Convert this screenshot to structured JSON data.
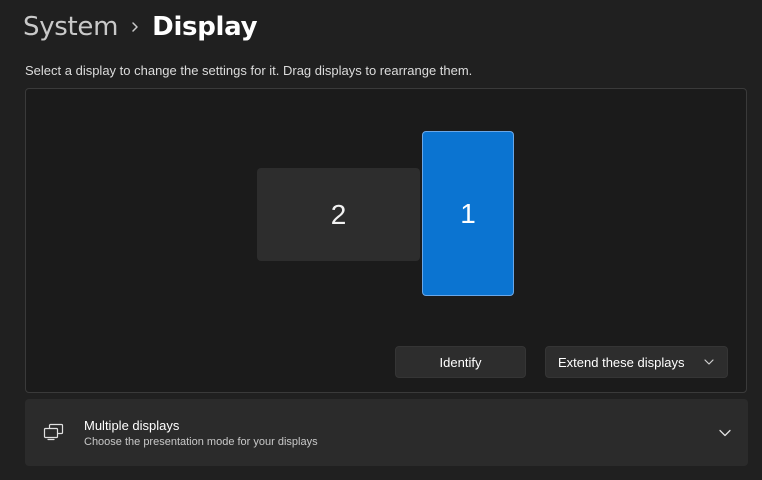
{
  "breadcrumb": {
    "parent": "System",
    "current": "Display",
    "separator_icon": "chevron-right-icon"
  },
  "instructions": "Select a display to change the settings for it. Drag displays to rearrange them.",
  "arrangement": {
    "monitors": [
      {
        "label": "2",
        "selected": false
      },
      {
        "label": "1",
        "selected": true
      }
    ],
    "identify_label": "Identify",
    "mode_select": {
      "value": "Extend these displays",
      "icon": "chevron-down-icon"
    }
  },
  "multiple_displays": {
    "icon": "multiple-displays-icon",
    "title": "Multiple displays",
    "description": "Choose the presentation mode for your displays",
    "expand_icon": "chevron-down-icon"
  },
  "colors": {
    "accent": "#0b74d1",
    "background": "#202020",
    "panel": "#1b1b1b",
    "card": "#2b2b2b"
  }
}
